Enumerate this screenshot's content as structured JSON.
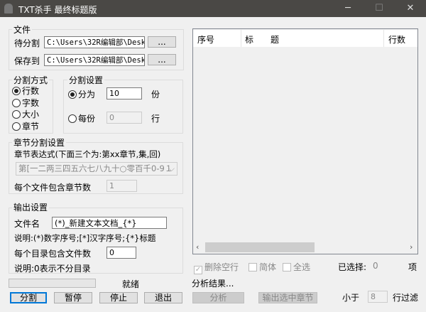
{
  "window": {
    "title": "TXT杀手 最终标题版",
    "minimize": "─",
    "maximize": "☐",
    "close": "✕"
  },
  "file_group": {
    "label": "文件",
    "source_label": "待分割",
    "source_value": "C:\\Users\\32R编辑部\\Deskt",
    "save_label": "保存到",
    "save_value": "C:\\Users\\32R编辑部\\Deskt",
    "browse": "..."
  },
  "split_mode": {
    "label": "分割方式",
    "options": [
      {
        "label": "行数",
        "selected": true
      },
      {
        "label": "字数",
        "selected": false
      },
      {
        "label": "大小",
        "selected": false
      },
      {
        "label": "章节",
        "selected": false
      }
    ]
  },
  "split_settings": {
    "label": "分割设置",
    "into_label": "分为",
    "into_value": "10",
    "into_unit": "份",
    "per_label": "每份",
    "per_value": "0",
    "per_unit": "行"
  },
  "chapter": {
    "label": "章节分割设置",
    "expr_label": "章节表达式(下面三个为:第xx章节,集,回)",
    "expr_value": "第[一二两三四五六七八九十○零百千0-9１",
    "per_file_label": "每个文件包含章节数",
    "per_file_value": "1"
  },
  "output": {
    "label": "输出设置",
    "filename_label": "文件名",
    "filename_value": "(*)_新建文本文档_{*}",
    "note1": "说明:(*)数字序号;[*]汉字序号;{*}标题",
    "per_dir_label": "每个目录包含文件数",
    "per_dir_value": "0",
    "note2": "说明:0表示不分目录"
  },
  "status": {
    "text": "就绪",
    "progress": 0
  },
  "buttons": {
    "split": "分割",
    "pause": "暂停",
    "stop": "停止",
    "exit": "退出"
  },
  "list": {
    "columns": [
      "序号",
      "标　　题",
      "行数"
    ],
    "rows": []
  },
  "options": {
    "remove_blank": {
      "label": "删除空行",
      "checked": true
    },
    "simplified": {
      "label": "简体",
      "checked": false
    },
    "select_all": {
      "label": "全选",
      "checked": false
    },
    "selected_label": "已选择:",
    "selected_count": "0",
    "selected_unit": "项"
  },
  "analysis": {
    "result": "分析结果...",
    "analyze": "分析",
    "export": "输出选中章节",
    "less_than": "小于",
    "filter_value": "8",
    "filter_label": "行过滤"
  }
}
